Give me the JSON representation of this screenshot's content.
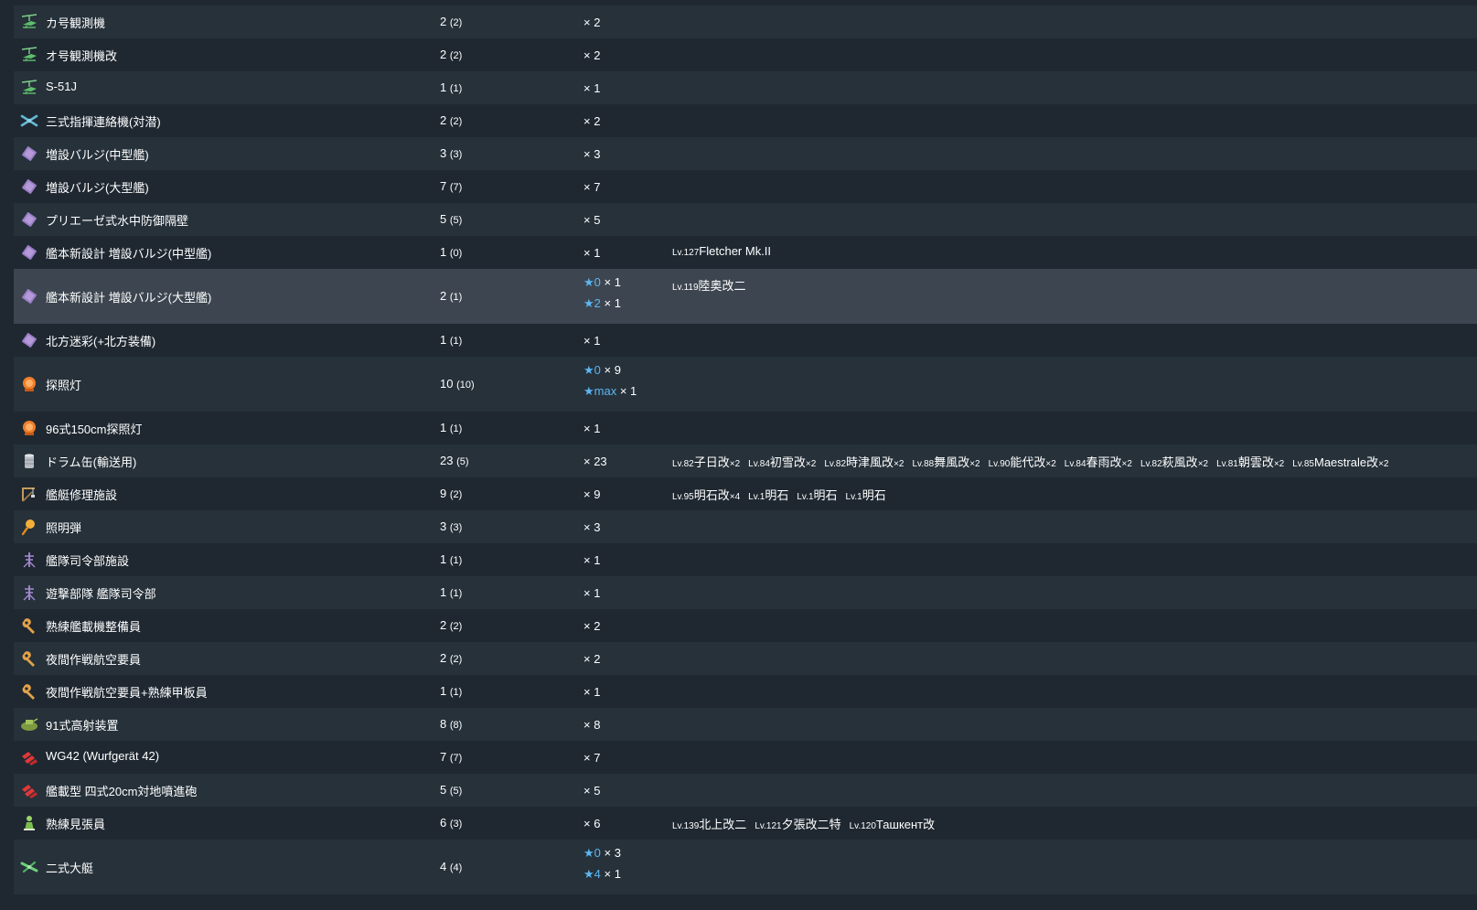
{
  "colors": {
    "row_even": "#26313a",
    "row_odd": "#1f2831",
    "row_highlight": "#3d4650",
    "star": "#5cb6f2",
    "text": "#ffffff"
  },
  "rows": [
    {
      "icon": "autogyro-icon",
      "name": "カ号観測機",
      "count": "2",
      "count_sub": "(2)",
      "improvements": [
        {
          "star": "",
          "mult": "× 2"
        }
      ],
      "ships": []
    },
    {
      "icon": "autogyro-icon",
      "name": "オ号観測機改",
      "count": "2",
      "count_sub": "(2)",
      "improvements": [
        {
          "star": "",
          "mult": "× 2"
        }
      ],
      "ships": []
    },
    {
      "icon": "autogyro-icon",
      "name": "S-51J",
      "count": "1",
      "count_sub": "(1)",
      "improvements": [
        {
          "star": "",
          "mult": "× 1"
        }
      ],
      "ships": []
    },
    {
      "icon": "liaison-plane-icon",
      "name": "三式指揮連絡機(対潜)",
      "count": "2",
      "count_sub": "(2)",
      "improvements": [
        {
          "star": "",
          "mult": "× 2"
        }
      ],
      "ships": []
    },
    {
      "icon": "bulge-icon",
      "name": "増設バルジ(中型艦)",
      "count": "3",
      "count_sub": "(3)",
      "improvements": [
        {
          "star": "",
          "mult": "× 3"
        }
      ],
      "ships": []
    },
    {
      "icon": "bulge-icon",
      "name": "増設バルジ(大型艦)",
      "count": "7",
      "count_sub": "(7)",
      "improvements": [
        {
          "star": "",
          "mult": "× 7"
        }
      ],
      "ships": []
    },
    {
      "icon": "bulge-icon",
      "name": "プリエーゼ式水中防御隔壁",
      "count": "5",
      "count_sub": "(5)",
      "improvements": [
        {
          "star": "",
          "mult": "× 5"
        }
      ],
      "ships": []
    },
    {
      "icon": "bulge-icon",
      "name": "艦本新設計 増設バルジ(中型艦)",
      "count": "1",
      "count_sub": "(0)",
      "improvements": [
        {
          "star": "",
          "mult": "× 1"
        }
      ],
      "ships": [
        {
          "lv": "Lv.127",
          "name": "Fletcher Mk.II",
          "mult": ""
        }
      ]
    },
    {
      "icon": "bulge-icon",
      "name": "艦本新設計 増設バルジ(大型艦)",
      "count": "2",
      "count_sub": "(1)",
      "highlight": true,
      "improvements": [
        {
          "star": "★0",
          "mult": "× 1"
        },
        {
          "star": "★2",
          "mult": "× 1"
        }
      ],
      "ships": [
        {
          "lv": "Lv.119",
          "name": "陸奥改二",
          "mult": ""
        }
      ]
    },
    {
      "icon": "bulge-icon",
      "name": "北方迷彩(+北方装備)",
      "count": "1",
      "count_sub": "(1)",
      "improvements": [
        {
          "star": "",
          "mult": "× 1"
        }
      ],
      "ships": []
    },
    {
      "icon": "searchlight-icon",
      "name": "探照灯",
      "count": "10",
      "count_sub": "(10)",
      "improvements": [
        {
          "star": "★0",
          "mult": "× 9"
        },
        {
          "star": "★max",
          "mult": "× 1"
        }
      ],
      "ships": []
    },
    {
      "icon": "searchlight-icon",
      "name": "96式150cm探照灯",
      "count": "1",
      "count_sub": "(1)",
      "improvements": [
        {
          "star": "",
          "mult": "× 1"
        }
      ],
      "ships": []
    },
    {
      "icon": "drum-icon",
      "name": "ドラム缶(輸送用)",
      "count": "23",
      "count_sub": "(5)",
      "improvements": [
        {
          "star": "",
          "mult": "× 23"
        }
      ],
      "ships": [
        {
          "lv": "Lv.82",
          "name": "子日改",
          "mult": "×2"
        },
        {
          "lv": "Lv.84",
          "name": "初雪改",
          "mult": "×2"
        },
        {
          "lv": "Lv.82",
          "name": "時津風改",
          "mult": "×2"
        },
        {
          "lv": "Lv.88",
          "name": "舞風改",
          "mult": "×2"
        },
        {
          "lv": "Lv.90",
          "name": "能代改",
          "mult": "×2"
        },
        {
          "lv": "Lv.84",
          "name": "春雨改",
          "mult": "×2"
        },
        {
          "lv": "Lv.82",
          "name": "萩風改",
          "mult": "×2"
        },
        {
          "lv": "Lv.81",
          "name": "朝雲改",
          "mult": "×2"
        },
        {
          "lv": "Lv.85",
          "name": "Maestrale改",
          "mult": "×2"
        }
      ]
    },
    {
      "icon": "repair-crane-icon",
      "name": "艦艇修理施設",
      "count": "9",
      "count_sub": "(2)",
      "improvements": [
        {
          "star": "",
          "mult": "× 9"
        }
      ],
      "ships": [
        {
          "lv": "Lv.95",
          "name": "明石改",
          "mult": "×4"
        },
        {
          "lv": "Lv.1",
          "name": "明石",
          "mult": ""
        },
        {
          "lv": "Lv.1",
          "name": "明石",
          "mult": ""
        },
        {
          "lv": "Lv.1",
          "name": "明石",
          "mult": ""
        }
      ]
    },
    {
      "icon": "star-shell-icon",
      "name": "照明弾",
      "count": "3",
      "count_sub": "(3)",
      "improvements": [
        {
          "star": "",
          "mult": "× 3"
        }
      ],
      "ships": []
    },
    {
      "icon": "fleet-command-icon",
      "name": "艦隊司令部施設",
      "count": "1",
      "count_sub": "(1)",
      "improvements": [
        {
          "star": "",
          "mult": "× 1"
        }
      ],
      "ships": []
    },
    {
      "icon": "fleet-command-icon",
      "name": "遊撃部隊 艦隊司令部",
      "count": "1",
      "count_sub": "(1)",
      "improvements": [
        {
          "star": "",
          "mult": "× 1"
        }
      ],
      "ships": []
    },
    {
      "icon": "wrench-icon",
      "name": "熟練艦載機整備員",
      "count": "2",
      "count_sub": "(2)",
      "improvements": [
        {
          "star": "",
          "mult": "× 2"
        }
      ],
      "ships": []
    },
    {
      "icon": "wrench-icon",
      "name": "夜間作戦航空要員",
      "count": "2",
      "count_sub": "(2)",
      "improvements": [
        {
          "star": "",
          "mult": "× 2"
        }
      ],
      "ships": []
    },
    {
      "icon": "wrench-icon",
      "name": "夜間作戦航空要員+熟練甲板員",
      "count": "1",
      "count_sub": "(1)",
      "improvements": [
        {
          "star": "",
          "mult": "× 1"
        }
      ],
      "ships": []
    },
    {
      "icon": "aa-fire-director-icon",
      "name": "91式高射装置",
      "count": "8",
      "count_sub": "(8)",
      "improvements": [
        {
          "star": "",
          "mult": "× 8"
        }
      ],
      "ships": []
    },
    {
      "icon": "rocket-launcher-icon",
      "name": "WG42 (Wurfgerät 42)",
      "count": "7",
      "count_sub": "(7)",
      "improvements": [
        {
          "star": "",
          "mult": "× 7"
        }
      ],
      "ships": []
    },
    {
      "icon": "rocket-launcher-icon",
      "name": "艦載型 四式20cm対地噴進砲",
      "count": "5",
      "count_sub": "(5)",
      "improvements": [
        {
          "star": "",
          "mult": "× 5"
        }
      ],
      "ships": []
    },
    {
      "icon": "lookout-icon",
      "name": "熟練見張員",
      "count": "6",
      "count_sub": "(3)",
      "improvements": [
        {
          "star": "",
          "mult": "× 6"
        }
      ],
      "ships": [
        {
          "lv": "Lv.139",
          "name": "北上改二",
          "mult": ""
        },
        {
          "lv": "Lv.121",
          "name": "夕張改二特",
          "mult": ""
        },
        {
          "lv": "Lv.120",
          "name": "Ташкент改",
          "mult": ""
        }
      ]
    },
    {
      "icon": "flying-boat-icon",
      "name": "二式大艇",
      "count": "4",
      "count_sub": "(4)",
      "improvements": [
        {
          "star": "★0",
          "mult": "× 3"
        },
        {
          "star": "★4",
          "mult": "× 1"
        }
      ],
      "ships": []
    }
  ]
}
